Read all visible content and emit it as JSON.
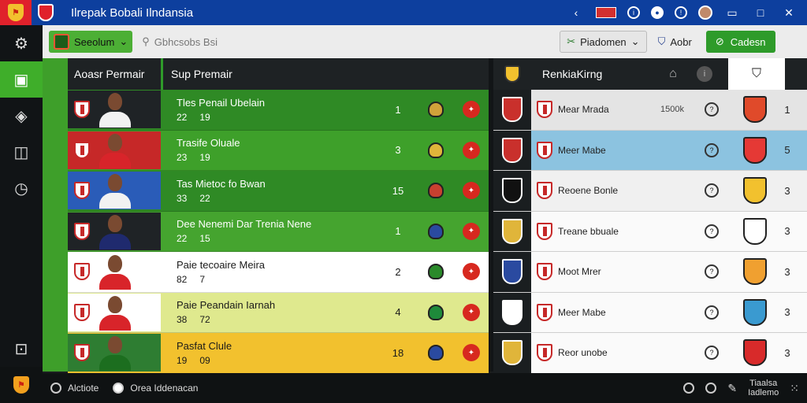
{
  "app": {
    "title": "Ilrepak Bobali Ilndansia"
  },
  "toolbar": {
    "season_label": "Seeolum",
    "search_placeholder": "Gbhcsobs Bsi",
    "dropdown_label": "Piadomen",
    "secondary_label": "Aobr",
    "action_label": "Cadesn"
  },
  "main": {
    "col1_header": "Aoasr Permair",
    "col2_header": "Sup Premair"
  },
  "players": [
    {
      "name": "Tles Penail Ubelain",
      "stat1": "22",
      "stat2": "19",
      "num": "1",
      "bg": "#2f8a25",
      "shirt": "#f2f2f2",
      "badge": "#d0a23a"
    },
    {
      "name": "Trasife Oluale",
      "stat1": "23",
      "stat2": "19",
      "num": "3",
      "bg": "#3ea02a",
      "shirt": "#d8242a",
      "badge": "#e0b53a"
    },
    {
      "name": "Tas Mietoc fo Bwan",
      "stat1": "33",
      "stat2": "22",
      "num": "15",
      "bg": "#2f8a25",
      "shirt": "#f2f2f2",
      "badge": "#c84030"
    },
    {
      "name": "Dee Nenemi Dar Trenia Nene",
      "stat1": "22",
      "stat2": "15",
      "num": "1",
      "bg": "#45a42f",
      "shirt": "#1f2a6e",
      "badge": "#2a4aa0"
    },
    {
      "name": "Paie tecoaire Meira",
      "stat1": "82",
      "stat2": "7",
      "num": "2",
      "bg": "#ffffff",
      "shirt": "#d8242a",
      "badge": "#2a8a2a"
    },
    {
      "name": "Paie Peandain Iarnah",
      "stat1": "38",
      "stat2": "72",
      "num": "4",
      "bg": "#dfe98e",
      "shirt": "#d8242a",
      "badge": "#1e8a3a"
    },
    {
      "name": "Pasfat Clule",
      "stat1": "19",
      "stat2": "09",
      "num": "18",
      "bg": "#f2c12e",
      "shirt": "#1c6e1f",
      "badge": "#2a4aa0"
    }
  ],
  "rankings": {
    "title": "RenkiaKirng",
    "rows": [
      {
        "name": "Mear Mrada",
        "value": "1500k",
        "pos": "1",
        "bg": "#e4e4e4",
        "flag": "#c9302c",
        "badge": "#e04a2a"
      },
      {
        "name": "Meer Mabe",
        "value": "",
        "pos": "5",
        "bg": "#8cc3e0",
        "flag": "#c9302c",
        "badge": "#e53935"
      },
      {
        "name": "Reoene Bonle",
        "value": "",
        "pos": "3",
        "bg": "#f0f0f0",
        "flag": "#111111",
        "badge": "#f2c12e"
      },
      {
        "name": "Treane bbuale",
        "value": "",
        "pos": "3",
        "bg": "#fafafa",
        "flag": "#e0b53a",
        "badge": "#ffffff"
      },
      {
        "name": "Moot Mrer",
        "value": "",
        "pos": "3",
        "bg": "#fafafa",
        "flag": "#2a4aa0",
        "badge": "#f0a030"
      },
      {
        "name": "Meer Mabe",
        "value": "",
        "pos": "3",
        "bg": "#fafafa",
        "flag": "#ffffff",
        "badge": "#3a9ad0"
      },
      {
        "name": "Reor unobe",
        "value": "",
        "pos": "3",
        "bg": "#fafafa",
        "flag": "#e0b53a",
        "badge": "#d82a2a"
      }
    ]
  },
  "statusbar": {
    "left1": "Alctiote",
    "left2": "Orea Iddenacan",
    "right_line1": "Tiaalsa",
    "right_line2": "Iadlemo"
  },
  "colors": {
    "accent_green": "#3fae2a",
    "title_blue": "#0d3f9e",
    "dark_bg": "#1a1d1f"
  }
}
